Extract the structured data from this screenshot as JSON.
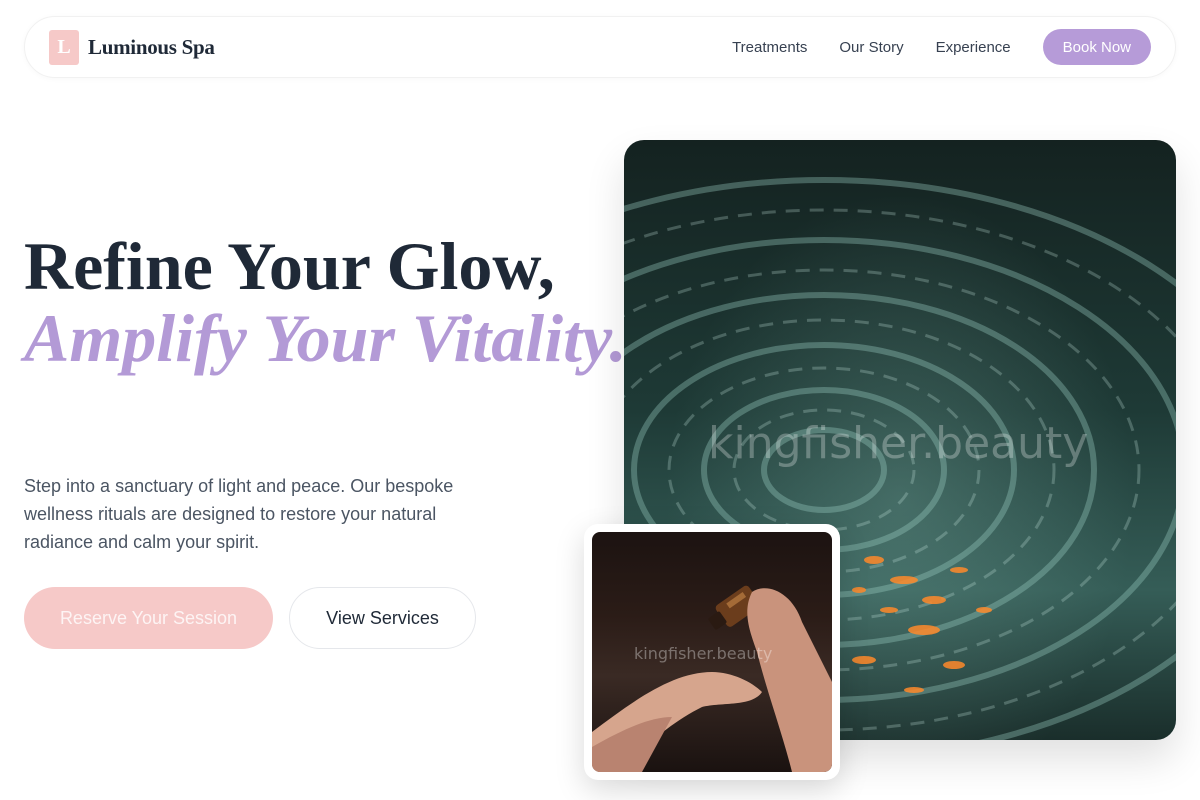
{
  "brand": {
    "logo_letter": "L",
    "name": "Luminous Spa"
  },
  "nav": {
    "links": [
      "Treatments",
      "Our Story",
      "Experience"
    ],
    "cta": "Book Now"
  },
  "hero": {
    "headline_line1": "Refine Your Glow,",
    "headline_line2": "Amplify Your Vitality.",
    "subtext": "Step into a sanctuary of light and peace. Our bespoke wellness rituals are designed to restore your natural radiance and calm your spirit.",
    "primary_button": "Reserve Your Session",
    "secondary_button": "View Services"
  },
  "images": {
    "main_watermark": "kingfisher.beauty",
    "inset_watermark": "kingfisher.beauty"
  },
  "colors": {
    "accent_lavender": "#b69bd8",
    "accent_pink": "#f6c9c8",
    "text_dark": "#1f2937"
  },
  "icons": {
    "logo": "letter-logo-icon"
  }
}
